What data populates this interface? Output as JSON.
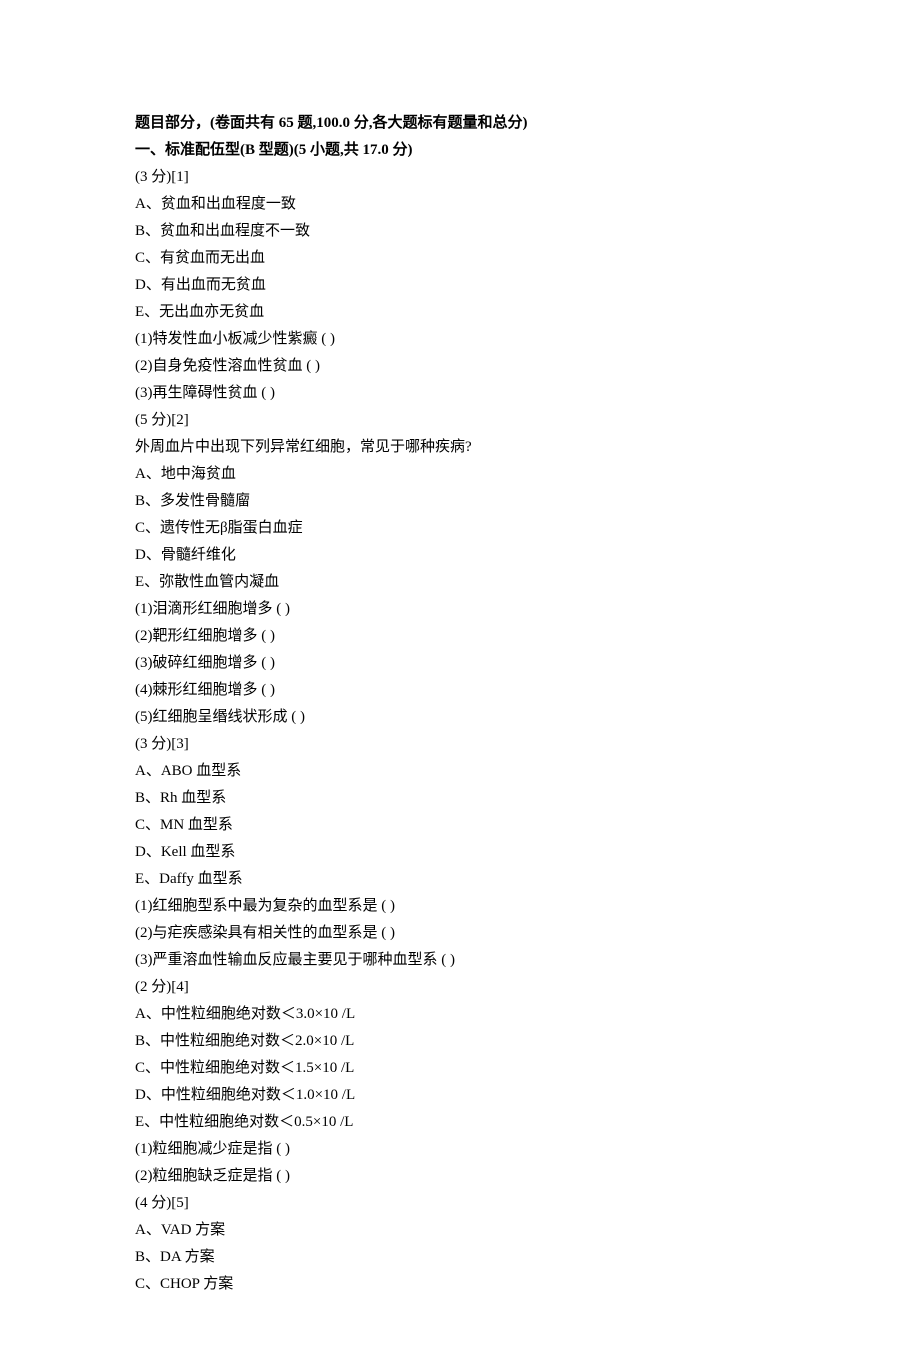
{
  "header_line": "题目部分，(卷面共有 65 题,100.0 分,各大题标有题量和总分)",
  "section1_title": "一、标准配伍型(B 型题)(5 小题,共 17.0 分)",
  "q1": {
    "score": "(3 分)[1]",
    "optA": "A、贫血和出血程度一致",
    "optB": "B、贫血和出血程度不一致",
    "optC": "C、有贫血而无出血",
    "optD": "D、有出血而无贫血",
    "optE": "E、无出血亦无贫血",
    "sub1": "(1)特发性血小板减少性紫癜 (    )",
    "sub2": "(2)自身免疫性溶血性贫血 (    )",
    "sub3": "(3)再生障碍性贫血 (    )"
  },
  "q2": {
    "score": "(5 分)[2]",
    "stem": "外周血片中出现下列异常红细胞，常见于哪种疾病?",
    "optA": "A、地中海贫血",
    "optB": "B、多发性骨髓廇",
    "optC": "C、遗传性无β脂蛋白血症",
    "optD": "D、骨髓纤维化",
    "optE": "E、弥散性血管内凝血",
    "sub1": "(1)泪滴形红细胞增多 (    )",
    "sub2": "(2)靶形红细胞增多 (    )",
    "sub3": "(3)破碎红细胞增多 (    )",
    "sub4": "(4)棘形红细胞增多 (    )",
    "sub5": "(5)红细胞呈缗线状形成 (    )"
  },
  "q3": {
    "score": "(3 分)[3]",
    "optA": "A、ABO 血型系",
    "optB": "B、Rh 血型系",
    "optC": "C、MN 血型系",
    "optD": "D、Kell 血型系",
    "optE": "E、Daffy 血型系",
    "sub1": "(1)红细胞型系中最为复杂的血型系是 (    )",
    "sub2": "(2)与疟疾感染具有相关性的血型系是 (    )",
    "sub3": "(3)严重溶血性输血反应最主要见于哪种血型系 (    )"
  },
  "q4": {
    "score": "(2 分)[4]",
    "optA": "A、中性粒细胞绝对数＜3.0×10   /L",
    "optB": "B、中性粒细胞绝对数＜2.0×10   /L",
    "optC": "C、中性粒细胞绝对数＜1.5×10   /L",
    "optD": "D、中性粒细胞绝对数＜1.0×10   /L",
    "optE": "E、中性粒细胞绝对数＜0.5×10   /L",
    "sub1": "(1)粒细胞减少症是指 (    )",
    "sub2": "(2)粒细胞缺乏症是指 (    )"
  },
  "q5": {
    "score": "(4 分)[5]",
    "optA": "A、VAD 方案",
    "optB": "B、DA 方案",
    "optC": "C、CHOP 方案"
  }
}
